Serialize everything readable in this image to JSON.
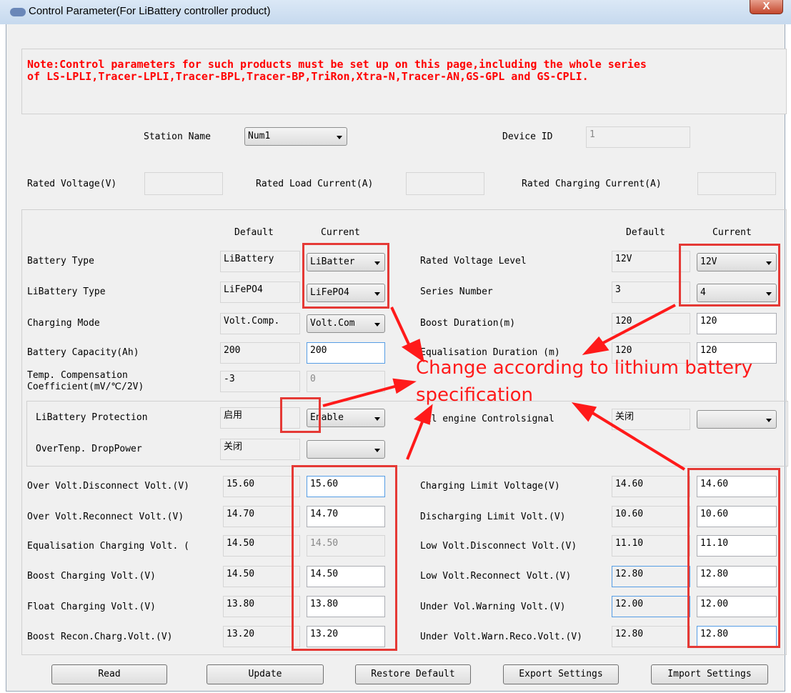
{
  "window": {
    "title": "Control Parameter(For LiBattery controller product)",
    "close_label": "X"
  },
  "note": {
    "line1": "Note:Control parameters for such products must be set up on this page,including the whole series",
    "line2": "of LS-LPLI,Tracer-LPLI,Tracer-BPL,Tracer-BP,TriRon,Xtra-N,Tracer-AN,GS-GPL and GS-CPLI."
  },
  "header": {
    "station_name_label": "Station Name",
    "station_name_value": "Num1",
    "device_id_label": "Device ID",
    "device_id_value": "1",
    "rated_voltage_label": "Rated Voltage(V)",
    "rated_voltage_value": "",
    "rated_load_current_label": "Rated Load Current(A)",
    "rated_load_current_value": "",
    "rated_charging_current_label": "Rated Charging Current(A)",
    "rated_charging_current_value": ""
  },
  "columns": {
    "default": "Default",
    "current": "Current"
  },
  "left": {
    "battery_type": {
      "label": "Battery Type",
      "default": "LiBattery",
      "current": "LiBatter"
    },
    "libattery_type": {
      "label": "LiBattery Type",
      "default": "LiFePO4",
      "current": "LiFePO4"
    },
    "charging_mode": {
      "label": "Charging Mode",
      "default": "Volt.Comp.",
      "current": "Volt.Com"
    },
    "battery_capacity": {
      "label": "Battery Capacity(Ah)",
      "default": "200",
      "current": "200"
    },
    "temp_comp": {
      "label_line1": "Temp. Compensation",
      "label_line2": "Coefficient(mV/℃/2V)",
      "default": "-3",
      "current": "0"
    },
    "libattery_protection": {
      "label": "LiBattery Protection",
      "default": "启用",
      "current": "Enable"
    },
    "overtemp_droppower": {
      "label": "OverTenp. DropPower",
      "default": "关闭",
      "current": ""
    }
  },
  "right": {
    "rated_voltage_level": {
      "label": "Rated Voltage Level",
      "default": "12V",
      "current": "12V"
    },
    "series_number": {
      "label": "Series Number",
      "default": "3",
      "current": "4"
    },
    "boost_duration": {
      "label": "Boost Duration(m)",
      "default": "120",
      "current": "120"
    },
    "equalisation_duration": {
      "label": "Equalisation Duration (m)",
      "default": "120",
      "current": "120"
    },
    "oil_engine": {
      "label": "Oil engine Controlsignal",
      "default": "关闭",
      "current": ""
    }
  },
  "volt_left": [
    {
      "label": "Over Volt.Disconnect Volt.(V)",
      "default": "15.60",
      "current": "15.60"
    },
    {
      "label": "Over Volt.Reconnect Volt.(V)",
      "default": "14.70",
      "current": "14.70"
    },
    {
      "label": "Equalisation Charging Volt. (",
      "default": "14.50",
      "current": "14.50"
    },
    {
      "label": "Boost Charging Volt.(V)",
      "default": "14.50",
      "current": "14.50"
    },
    {
      "label": "Float Charging Volt.(V)",
      "default": "13.80",
      "current": "13.80"
    },
    {
      "label": "Boost Recon.Charg.Volt.(V)",
      "default": "13.20",
      "current": "13.20"
    }
  ],
  "volt_right": [
    {
      "label": "Charging Limit Voltage(V)",
      "default": "14.60",
      "current": "14.60"
    },
    {
      "label": "Discharging Limit Volt.(V)",
      "default": "10.60",
      "current": "10.60"
    },
    {
      "label": "Low Volt.Disconnect Volt.(V)",
      "default": "11.10",
      "current": "11.10"
    },
    {
      "label": "Low Volt.Reconnect Volt.(V)",
      "default": "12.80",
      "current": "12.80"
    },
    {
      "label": "Under Vol.Warning Volt.(V)",
      "default": "12.00",
      "current": "12.00"
    },
    {
      "label": "Under Volt.Warn.Reco.Volt.(V)",
      "default": "12.80",
      "current": "12.80"
    }
  ],
  "buttons": {
    "read": "Read",
    "update": "Update",
    "restore_default": "Restore Default",
    "export_settings": "Export Settings",
    "import_settings": "Import Settings"
  },
  "annotation": {
    "line1": "Change according to lithium battery",
    "line2": "specification",
    "color": "#ff1a1a"
  }
}
